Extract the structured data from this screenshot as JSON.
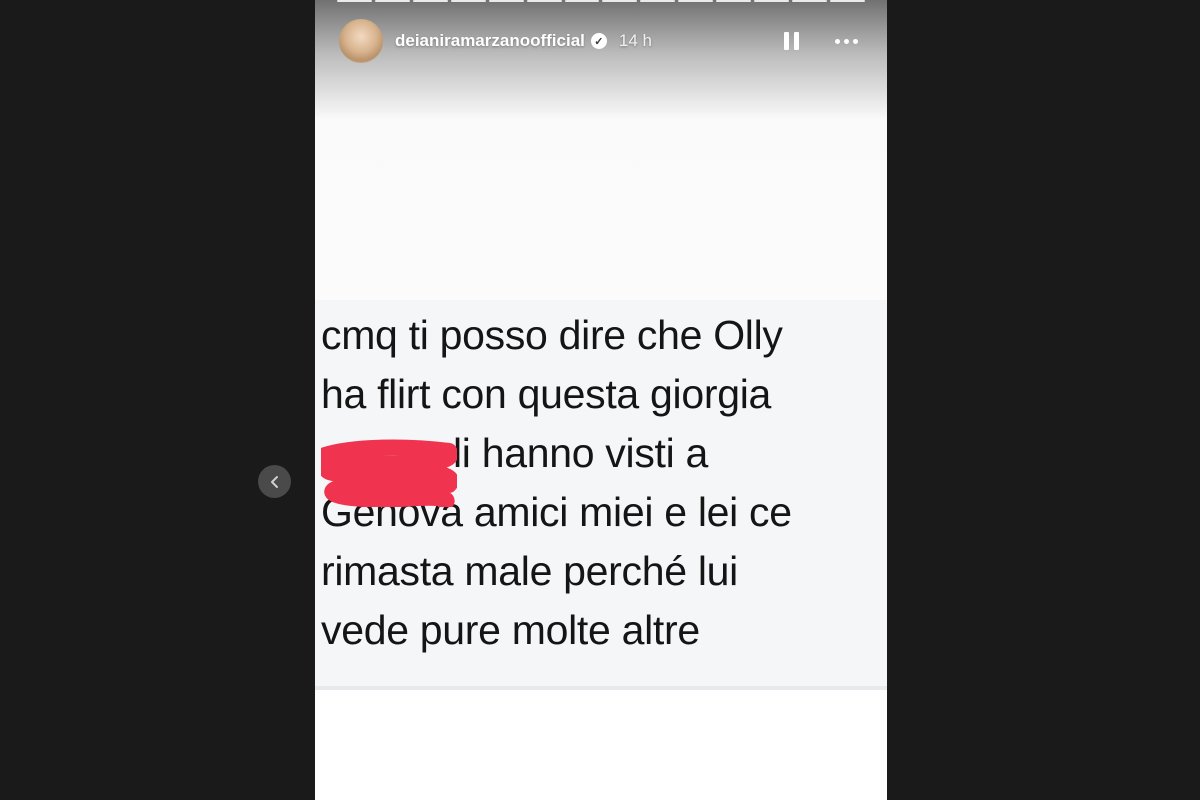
{
  "story": {
    "username": "deianiramarzanoofficial",
    "time_ago": "14 h",
    "progress_segments": 14,
    "message_lines": [
      "cmq ti posso dire che Olly",
      "ha flirt con questa giorgia",
      "li hanno visti a",
      "Genova amici miei e lei ce",
      "rimasta male perché lui",
      "vede pure molte altre"
    ]
  },
  "icons": {
    "verified": "verified-badge-icon",
    "pause": "pause-icon",
    "more": "more-options-icon",
    "previous": "chevron-left-icon"
  },
  "colors": {
    "background": "#1a1a1a",
    "redaction": "#f0334f",
    "text": "#151515"
  }
}
